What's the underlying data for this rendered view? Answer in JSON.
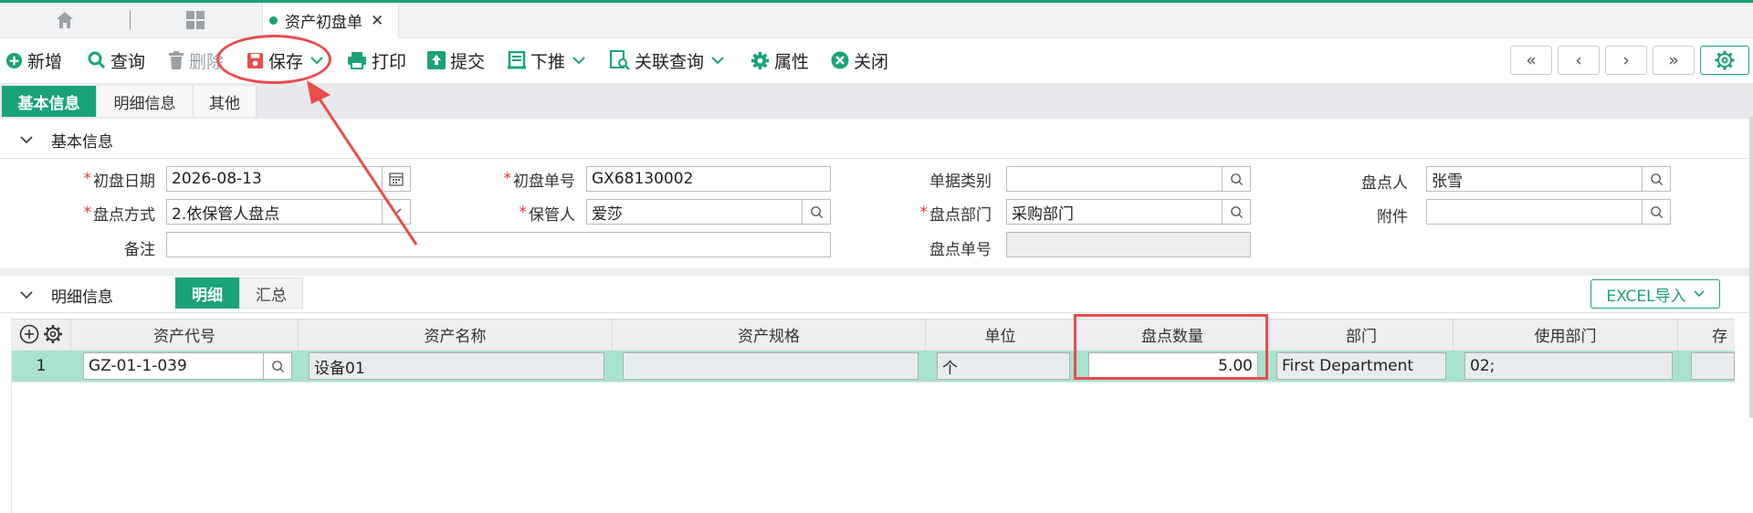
{
  "tabs": {
    "active_label": "资产初盘单",
    "close_glyph": "✕"
  },
  "toolbar": {
    "new_label": "新增",
    "query_label": "查询",
    "delete_label": "删除",
    "save_label": "保存",
    "print_label": "打印",
    "submit_label": "提交",
    "push_label": "下推",
    "related_query_label": "关联查询",
    "properties_label": "属性",
    "close_label": "关闭",
    "nav_first": "«",
    "nav_prev": "‹",
    "nav_next": "›",
    "nav_last": "»"
  },
  "subtabs": [
    "基本信息",
    "明细信息",
    "其他"
  ],
  "basic_section": {
    "title": "基本信息",
    "fields": {
      "initial_date": {
        "label": "初盘日期",
        "value": "2026-08-13"
      },
      "initial_no": {
        "label": "初盘单号",
        "value": "GX68130002"
      },
      "doc_type": {
        "label": "单据类别",
        "value": ""
      },
      "counter": {
        "label": "盘点人",
        "value": "张雪"
      },
      "count_method": {
        "label": "盘点方式",
        "value": "2.依保管人盘点"
      },
      "custodian": {
        "label": "保管人",
        "value": "爱莎"
      },
      "count_dept": {
        "label": "盘点部门",
        "value": "采购部门"
      },
      "attachment": {
        "label": "附件",
        "value": ""
      },
      "remark": {
        "label": "备注",
        "value": ""
      },
      "count_no": {
        "label": "盘点单号",
        "value": ""
      }
    }
  },
  "detail_section": {
    "title": "明细信息",
    "segments": [
      "明细",
      "汇总"
    ],
    "excel_label": "EXCEL导入",
    "columns": [
      "资产代号",
      "资产名称",
      "资产规格",
      "单位",
      "盘点数量",
      "部门",
      "使用部门",
      "存"
    ],
    "rows": [
      {
        "index": "1",
        "asset_code": "GZ-01-1-039",
        "asset_name": "设备01",
        "asset_spec": "",
        "unit": "个",
        "quantity": "5.00",
        "dept": "First Department",
        "use_dept": "02;"
      }
    ]
  },
  "colors": {
    "accent": "#1aa37a",
    "annotation": "#e94d4d",
    "row_highlight": "#a9e3cd",
    "required": "#e0343a"
  }
}
